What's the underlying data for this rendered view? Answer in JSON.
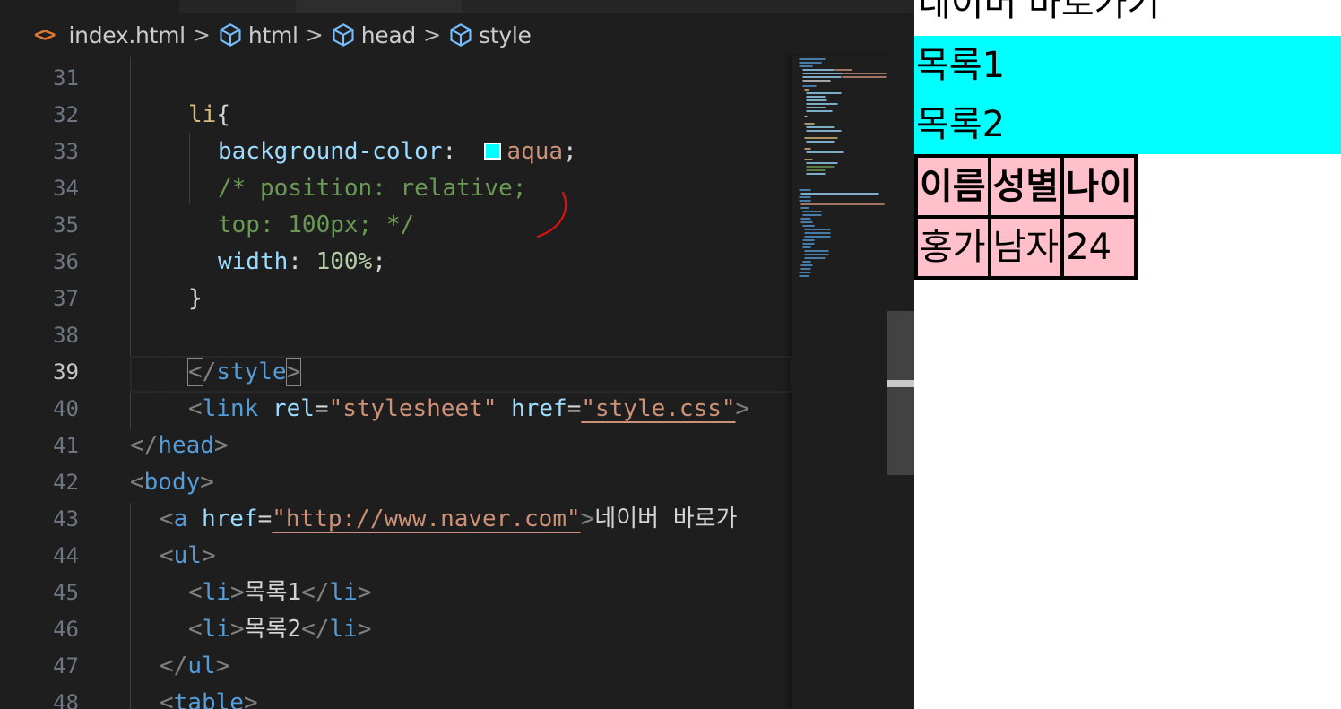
{
  "breadcrumb": {
    "file_icon": "<>",
    "items": [
      "index.html",
      "html",
      "head",
      "style"
    ],
    "separator": ">"
  },
  "colors": {
    "editor_bg": "#1e1e1e",
    "selector": "#d7ba7d",
    "property": "#9cdcfe",
    "value": "#ce9178",
    "comment": "#6a9955",
    "tag": "#569cd6",
    "swatch": "#00ffff",
    "preview_list_bg": "#00ffff",
    "preview_table_bg": "#ffc0cb"
  },
  "code": {
    "current_line": 39,
    "lines": [
      {
        "num": "31"
      },
      {
        "num": "32",
        "selector": "li",
        "open": "{"
      },
      {
        "num": "33",
        "prop": "background-color",
        "colon": ": ",
        "value": "aqua",
        "semi": ";"
      },
      {
        "num": "34",
        "comment": "/* position: relative;"
      },
      {
        "num": "35",
        "comment": "top: 100px; */"
      },
      {
        "num": "36",
        "prop": "width",
        "colon": ": ",
        "value": "100%",
        "semi": ";"
      },
      {
        "num": "37",
        "close": "}"
      },
      {
        "num": "38"
      },
      {
        "num": "39",
        "lt": "<",
        "slash": "/",
        "tag": "style",
        "gt": ">"
      },
      {
        "num": "40",
        "lt": "<",
        "tag": "link",
        "attr1": "rel",
        "eq": "=",
        "val1": "\"stylesheet\"",
        "attr2": "href",
        "val2": "\"style.css\"",
        "gt": ">"
      },
      {
        "num": "41",
        "lt": "</",
        "tag": "head",
        "gt": ">"
      },
      {
        "num": "42",
        "lt": "<",
        "tag": "body",
        "gt": ">"
      },
      {
        "num": "43",
        "lt": "<",
        "tag": "a",
        "attr1": "href",
        "eq": "=",
        "val1": "\"http://www.naver.com\"",
        "gt": ">",
        "text": "네이버 바로가"
      },
      {
        "num": "44",
        "lt": "<",
        "tag": "ul",
        "gt": ">"
      },
      {
        "num": "45",
        "lt": "<",
        "tag": "li",
        "gt": ">",
        "text": "목록1",
        "lt2": "</",
        "tag2": "li",
        "gt2": ">"
      },
      {
        "num": "46",
        "lt": "<",
        "tag": "li",
        "gt": ">",
        "text": "목록2",
        "lt2": "</",
        "tag2": "li",
        "gt2": ">"
      },
      {
        "num": "47",
        "lt": "</",
        "tag": "ul",
        "gt": ">"
      },
      {
        "num": "48",
        "lt": "<",
        "tag": "table",
        "gt": ">"
      }
    ]
  },
  "preview": {
    "link_text": "네이버 바로가기",
    "list_items": [
      "목록1",
      "목록2"
    ],
    "table_headers": [
      "이름",
      "성별",
      "나이"
    ],
    "table_rows": [
      [
        "홍가",
        "남자",
        "24"
      ]
    ]
  }
}
